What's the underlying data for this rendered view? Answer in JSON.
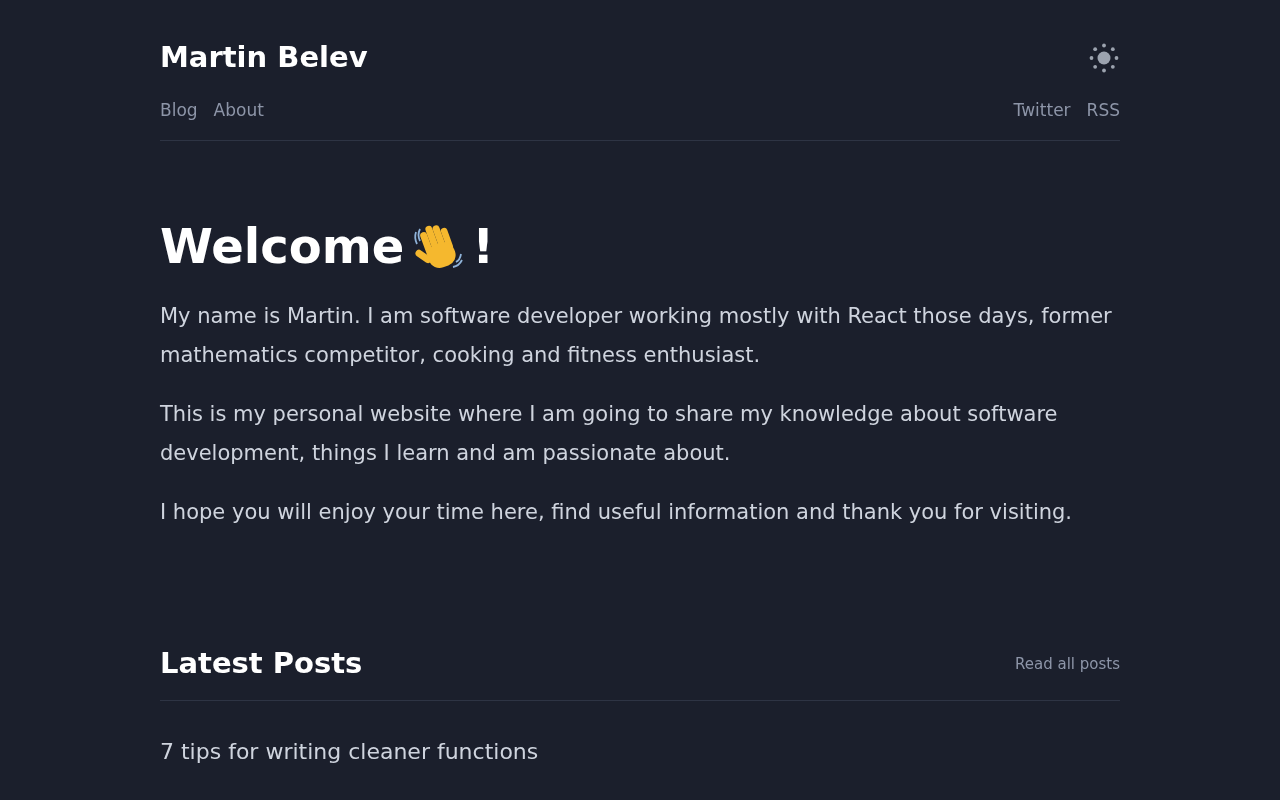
{
  "site_title": "Martin Belev",
  "nav_left": [
    {
      "label": "Blog"
    },
    {
      "label": "About"
    }
  ],
  "nav_right": [
    {
      "label": "Twitter"
    },
    {
      "label": "RSS"
    }
  ],
  "hero": {
    "heading_start": "Welcome",
    "heading_end": "!",
    "paragraphs": [
      "My name is Martin. I am software developer working mostly with React those days, former mathematics competitor, cooking and fitness enthusiast.",
      "This is my personal website where I am going to share my knowledge about software development, things I learn and am passionate about.",
      "I hope you will enjoy your time here, find useful information and thank you for visiting."
    ]
  },
  "latest_posts": {
    "title": "Latest Posts",
    "read_all": "Read all posts",
    "posts": [
      {
        "title": "7 tips for writing cleaner functions"
      }
    ]
  }
}
